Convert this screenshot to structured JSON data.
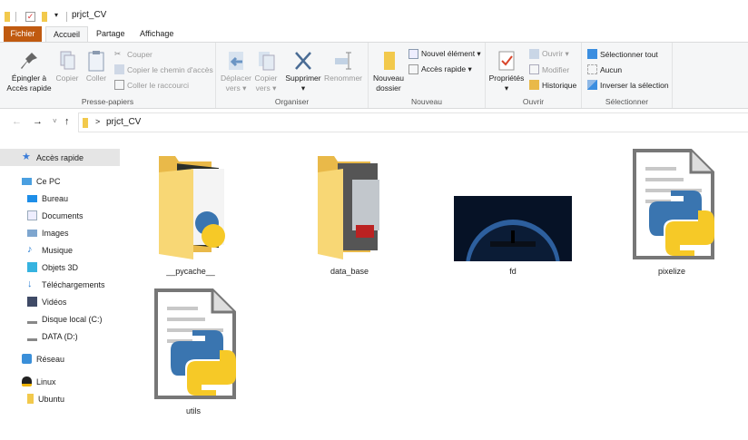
{
  "window": {
    "title": "prjct_CV"
  },
  "tabs": [
    {
      "label": "Fichier"
    },
    {
      "label": "Accueil"
    },
    {
      "label": "Partage"
    },
    {
      "label": "Affichage"
    }
  ],
  "ribbon": {
    "presse_papiers": {
      "label": "Presse-papiers",
      "pin": "Épingler à",
      "pin2": "Accès rapide",
      "copy": "Copier",
      "paste": "Coller",
      "cut": "Couper",
      "copy_path": "Copier le chemin d'accès",
      "paste_shortcut": "Coller le raccourci"
    },
    "organiser": {
      "label": "Organiser",
      "move": "Déplacer",
      "move2": "vers ▾",
      "copyto": "Copier",
      "copyto2": "vers ▾",
      "delete": "Supprimer",
      "delete2": "▾",
      "rename": "Renommer"
    },
    "nouveau": {
      "label": "Nouveau",
      "new_folder": "Nouveau",
      "new_folder2": "dossier",
      "new_item": "Nouvel élément ▾",
      "easy_access": "Accès rapide ▾"
    },
    "ouvrir": {
      "label": "Ouvrir",
      "properties": "Propriétés",
      "properties2": "▾",
      "open": "Ouvrir ▾",
      "edit": "Modifier",
      "history": "Historique"
    },
    "selectionner": {
      "label": "Sélectionner",
      "select_all": "Sélectionner tout",
      "select_none": "Aucun",
      "invert": "Inverser la sélection"
    }
  },
  "address": {
    "back": "←",
    "forward": "→",
    "recent": "˅",
    "up": "↑",
    "separator": ">",
    "path": "prjct_CV"
  },
  "sidebar": {
    "items": [
      {
        "label": "Accès rapide",
        "icon": "star-icon"
      },
      {
        "label": "Ce PC",
        "icon": "pc-icon"
      },
      {
        "label": "Bureau",
        "icon": "desktop-icon"
      },
      {
        "label": "Documents",
        "icon": "documents-icon"
      },
      {
        "label": "Images",
        "icon": "images-icon"
      },
      {
        "label": "Musique",
        "icon": "music-icon"
      },
      {
        "label": "Objets 3D",
        "icon": "cube-icon"
      },
      {
        "label": "Téléchargements",
        "icon": "download-icon"
      },
      {
        "label": "Vidéos",
        "icon": "video-icon"
      },
      {
        "label": "Disque local (C:)",
        "icon": "drive-icon"
      },
      {
        "label": "DATA (D:)",
        "icon": "drive-icon"
      },
      {
        "label": "Réseau",
        "icon": "network-icon"
      },
      {
        "label": "Linux",
        "icon": "linux-icon"
      },
      {
        "label": "Ubuntu",
        "icon": "folder-icon"
      }
    ]
  },
  "files": [
    {
      "name": "__pycache__",
      "type": "folder"
    },
    {
      "name": "data_base",
      "type": "folder"
    },
    {
      "name": "fd",
      "type": "image"
    },
    {
      "name": "pixelize",
      "type": "python"
    },
    {
      "name": "utils",
      "type": "python"
    }
  ],
  "colors": {
    "file_tab": "#c05a10",
    "folder": "#f8d775",
    "python_blue": "#3a75b0",
    "python_yellow": "#f6c927",
    "selection": "#e5e5e5"
  }
}
